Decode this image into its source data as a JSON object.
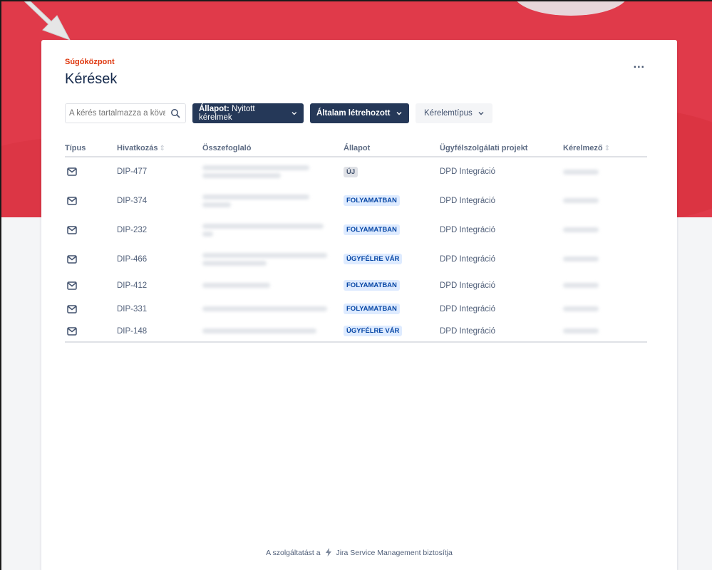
{
  "breadcrumb": "Súgóközpont",
  "page_title": "Kérések",
  "more_menu": "...",
  "filters": {
    "search_placeholder": "A kérés tartalmazza a kövε",
    "status_prefix": "Állapot:",
    "status_value": "Nyitott kérelmek",
    "created_by": "Általam létrehozott",
    "request_type": "Kérelemtípus"
  },
  "table": {
    "headers": {
      "type": "Típus",
      "reference": "Hivatkozás",
      "summary": "Összefoglaló",
      "status": "Állapot",
      "project": "Ügyfélszolgálati projekt",
      "requester": "Kérelmező"
    },
    "rows": [
      {
        "reference": "DIP-477",
        "status": "ÚJ",
        "project": "DPD Integráció"
      },
      {
        "reference": "DIP-374",
        "status": "FOLYAMATBAN",
        "project": "DPD Integráció"
      },
      {
        "reference": "DIP-232",
        "status": "FOLYAMATBAN",
        "project": "DPD Integráció"
      },
      {
        "reference": "DIP-466",
        "status": "ÜGYFÉLRE VÁR",
        "project": "DPD Integráció"
      },
      {
        "reference": "DIP-412",
        "status": "FOLYAMATBAN",
        "project": "DPD Integráció"
      },
      {
        "reference": "DIP-331",
        "status": "FOLYAMATBAN",
        "project": "DPD Integráció"
      },
      {
        "reference": "DIP-148",
        "status": "ÜGYFÉLRE VÁR",
        "project": "DPD Integráció"
      }
    ]
  },
  "footer": {
    "prefix": "A szolgáltatást a",
    "suffix": "Jira Service Management biztosítja"
  },
  "colors": {
    "banner": "#e03a4a",
    "breadcrumb": "#de350b",
    "button_dark": "#253858",
    "lozenge_progress_bg": "#deebff",
    "lozenge_progress_fg": "#0747a6"
  },
  "icons": [
    "search-icon",
    "chevron-down-icon",
    "mail-icon",
    "jira-icon",
    "more-icon",
    "arrow-cursor-icon"
  ]
}
